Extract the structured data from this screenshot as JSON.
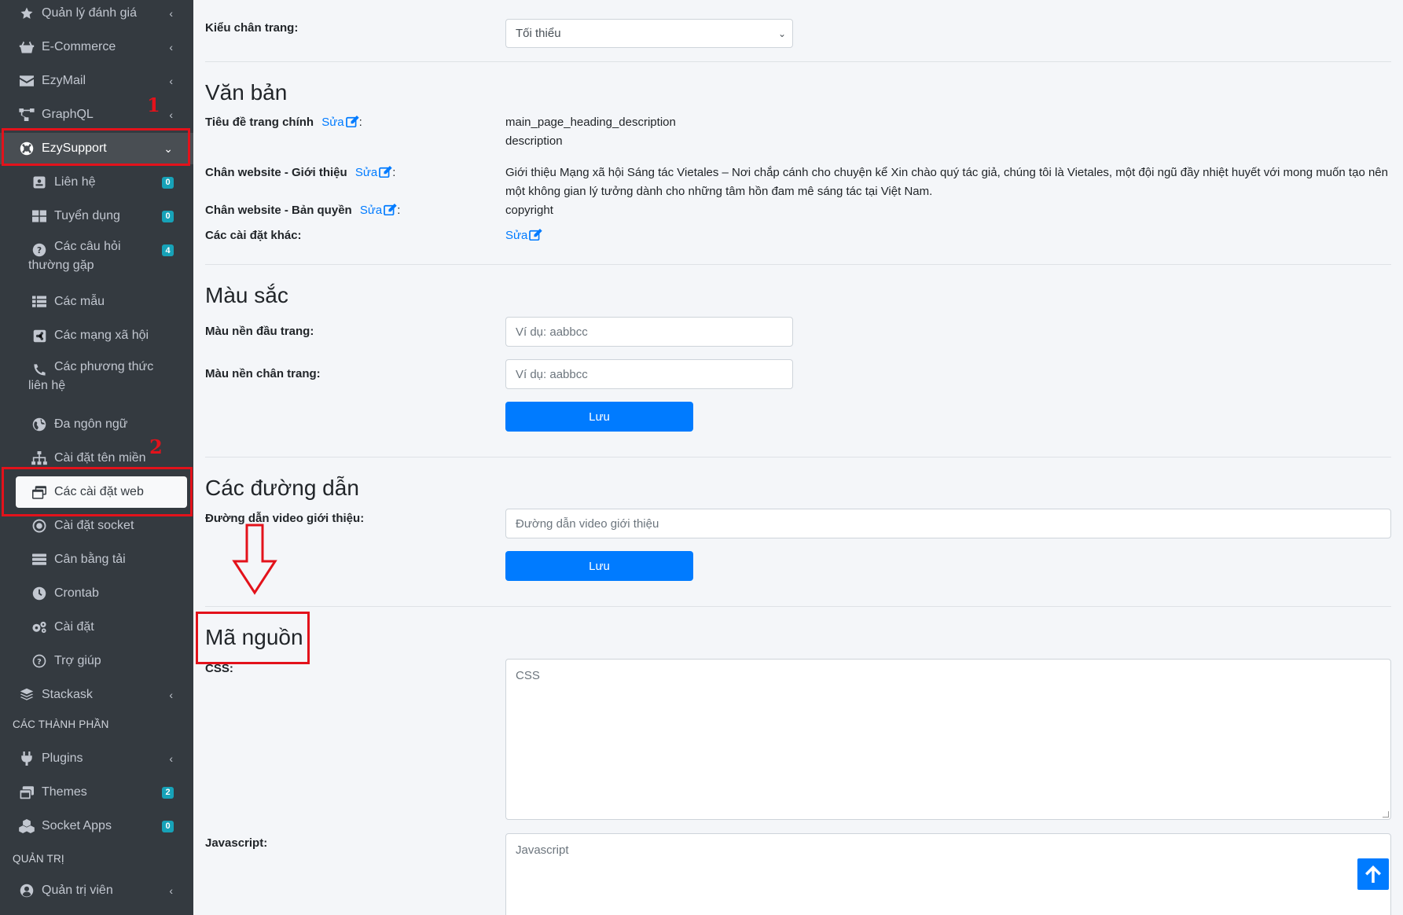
{
  "sidebar": {
    "items": [
      {
        "label": "Quản lý đánh giá",
        "icon": "star-icon"
      },
      {
        "label": "E-Commerce",
        "icon": "basket-icon"
      },
      {
        "label": "EzyMail",
        "icon": "envelope-icon"
      },
      {
        "label": "GraphQL",
        "icon": "project-diagram-icon"
      },
      {
        "label": "EzySupport",
        "icon": "life-ring-icon"
      },
      {
        "label": "Stackask",
        "icon": "layers-icon"
      }
    ],
    "sub_items": [
      {
        "label": "Liên hệ",
        "badge": "0"
      },
      {
        "label": "Tuyển dụng",
        "badge": "0"
      },
      {
        "label": "Các câu hỏi thường gặp",
        "badge": "4"
      },
      {
        "label": "Các mẫu"
      },
      {
        "label": "Các mạng xã hội"
      },
      {
        "label": "Các phương thức liên hệ"
      },
      {
        "label": "Đa ngôn ngữ"
      },
      {
        "label": "Cài đặt tên miền"
      },
      {
        "label": "Các cài đặt web"
      },
      {
        "label": "Cài đặt socket"
      },
      {
        "label": "Cân bằng tải"
      },
      {
        "label": "Crontab"
      },
      {
        "label": "Cài đặt"
      },
      {
        "label": "Trợ giúp"
      }
    ],
    "header_components": "CÁC THÀNH PHẦN",
    "component_items": [
      {
        "label": "Plugins"
      },
      {
        "label": "Themes",
        "badge": "2"
      },
      {
        "label": "Socket Apps",
        "badge": "0"
      }
    ],
    "header_admin": "QUẢN TRỊ",
    "admin_items": [
      {
        "label": "Quản trị viên"
      }
    ]
  },
  "annotations": {
    "marker_1": "1",
    "marker_2": "2"
  },
  "content": {
    "footer_type_label": "Kiểu chân trang:",
    "footer_type_value": "Tối thiểu",
    "text_section": {
      "title": "Văn bản",
      "edit_label": "Sửa",
      "main_heading_label": "Tiêu đề trang chính",
      "main_heading_value_1": "main_page_heading_description",
      "main_heading_value_2": "description",
      "footer_intro_label": "Chân website - Giới thiệu",
      "footer_intro_value": "Giới thiệu Mạng xã hội Sáng tác Vietales – Nơi chắp cánh cho chuyện kể Xin chào quý tác giả, chúng tôi là Vietales, một đội ngũ đầy nhiệt huyết với mong muốn tạo nên một không gian lý tưởng dành cho những tâm hồn đam mê sáng tác tại Việt Nam.",
      "footer_copyright_label": "Chân website - Bản quyền",
      "footer_copyright_value": "copyright",
      "other_settings_label": "Các cài đặt khác:"
    },
    "color_section": {
      "title": "Màu sắc",
      "header_bg_label": "Màu nền đầu trang:",
      "header_bg_placeholder": "Ví dụ: aabbcc",
      "footer_bg_label": "Màu nền chân trang:",
      "footer_bg_placeholder": "Ví dụ: aabbcc",
      "save_label": "Lưu"
    },
    "links_section": {
      "title": "Các đường dẫn",
      "video_label": "Đường dẫn video giới thiệu:",
      "video_placeholder": "Đường dẫn video giới thiệu",
      "save_label": "Lưu"
    },
    "source_section": {
      "title": "Mã nguồn",
      "css_label": "CSS:",
      "css_placeholder": "CSS",
      "js_label": "Javascript:",
      "js_placeholder": "Javascript"
    }
  },
  "colors": {
    "sidebar_bg": "#343a40",
    "primary": "#007bff",
    "badge": "#17a2b8",
    "annotation_red": "#e3121b"
  }
}
